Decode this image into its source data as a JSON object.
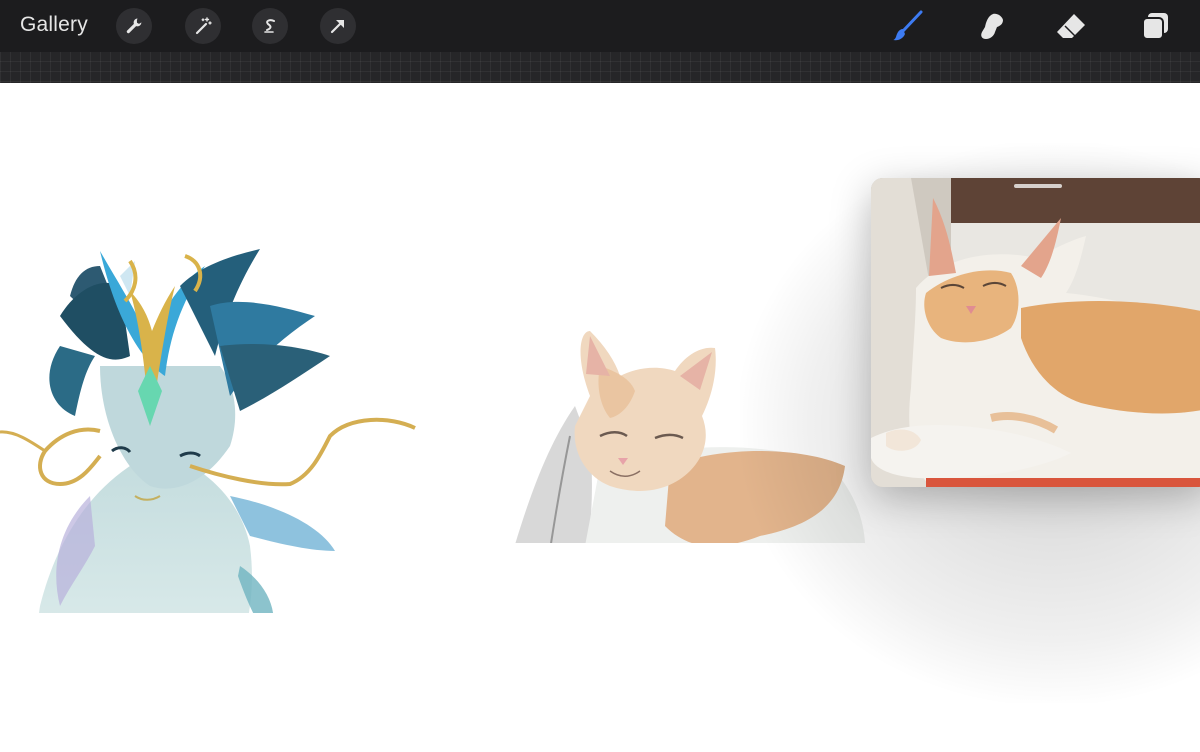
{
  "toolbar": {
    "gallery_label": "Gallery",
    "left_tools": [
      "wrench-icon",
      "magic-wand-icon",
      "selection-s-icon",
      "transform-arrow-icon"
    ],
    "right_tools": [
      "brush-icon",
      "smudge-icon",
      "eraser-icon",
      "layers-icon"
    ],
    "active_tool": "brush",
    "accent_color": "#3d7bf2"
  },
  "canvas": {
    "background": "#ffffff",
    "artworks": [
      "dragon-drawing",
      "cat-drawing"
    ]
  },
  "reference": {
    "content": "cat-reference-photo"
  }
}
